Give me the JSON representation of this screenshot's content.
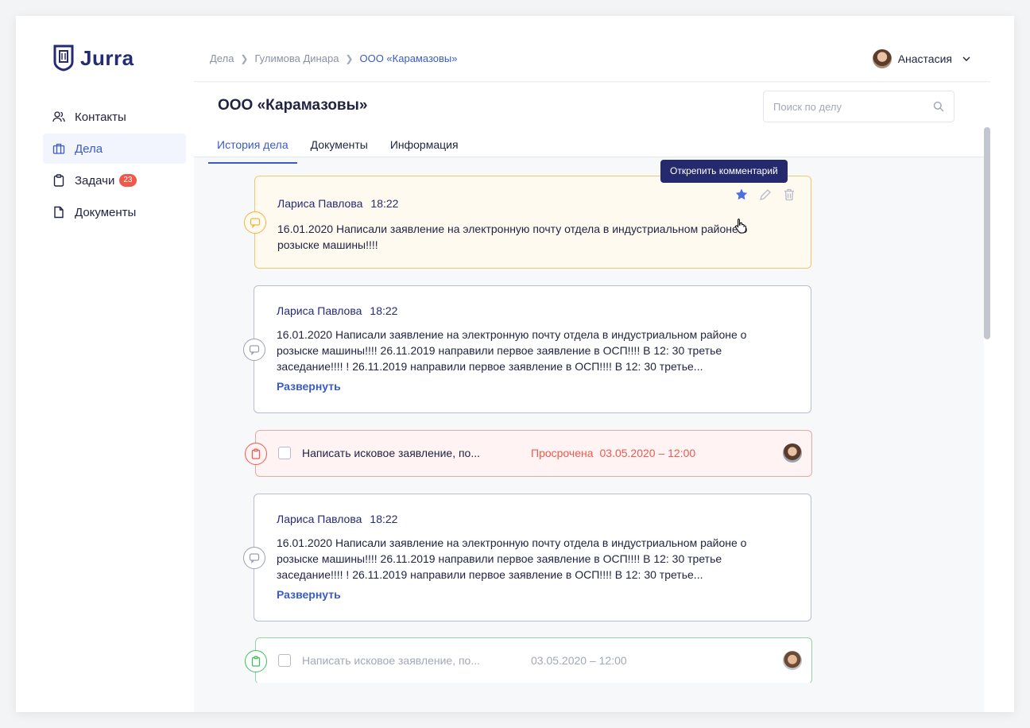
{
  "app": {
    "name": "Jurra"
  },
  "sidebar": {
    "items": [
      {
        "label": "Контакты",
        "icon": "users-icon",
        "active": false
      },
      {
        "label": "Дела",
        "icon": "briefcase-icon",
        "active": true
      },
      {
        "label": "Задачи",
        "icon": "clipboard-icon",
        "active": false,
        "badge": "23"
      },
      {
        "label": "Документы",
        "icon": "document-icon",
        "active": false
      }
    ]
  },
  "breadcrumb": [
    "Дела",
    "Гулимова Динара",
    "ООО «Карамазовы»"
  ],
  "user": {
    "name": "Анастасия"
  },
  "case": {
    "title": "ООО «Карамазовы»"
  },
  "search": {
    "placeholder": "Поиск по делу"
  },
  "tabs": [
    "История дела",
    "Документы",
    "Информация"
  ],
  "tooltip": "Открепить комментарий",
  "feed": {
    "pinned": {
      "author": "Лариса Павлова",
      "time": "18:22",
      "text": "16.01.2020 Написали заявление на электронную почту отдела в индустриальном районе о розыске машины!!!!"
    },
    "comment1": {
      "author": "Лариса Павлова",
      "time": "18:22",
      "text": "16.01.2020 Написали заявление на электронную почту отдела в индустриальном районе о розыске машины!!!! 26.11.2019 направили первое заявление в ОСП!!!! В 12: 30 третье заседание!!!! ! 26.11.2019 направили первое заявление в ОСП!!!! В 12: 30 третье...",
      "expand": "Развернуть"
    },
    "task1": {
      "title": "Написать исковое заявление, по...",
      "status": "Просрочена",
      "date": "03.05.2020 – 12:00"
    },
    "comment2": {
      "author": "Лариса Павлова",
      "time": "18:22",
      "text": "16.01.2020 Написали заявление на электронную почту отдела в индустриальном районе о розыске машины!!!! 26.11.2019 направили первое заявление в ОСП!!!! В 12: 30 третье заседание!!!! ! 26.11.2019 направили первое заявление в ОСП!!!! В 12: 30 третье...",
      "expand": "Развернуть"
    },
    "task2": {
      "title": "Написать исковое заявление, по...",
      "date": "03.05.2020 – 12:00"
    }
  },
  "colors": {
    "brand": "#262a73",
    "accent": "#3a5bc7",
    "danger": "#ee5a4d",
    "pinned": "#f2b342",
    "success": "#3cbf5e"
  }
}
